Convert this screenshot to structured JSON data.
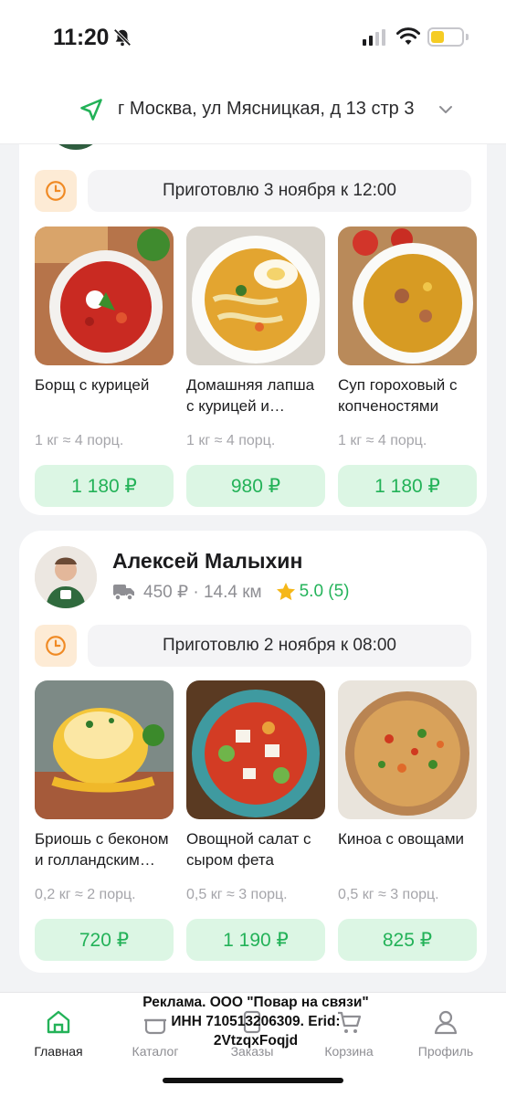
{
  "status_bar": {
    "time": "11:20",
    "battery_color": "#f5cc23"
  },
  "header": {
    "address": "г Москва, ул Мясницкая, д 13 стр 3",
    "location_icon": "navigation-arrow-icon",
    "chevron_icon": "chevron-down-icon"
  },
  "cards": [
    {
      "ready_text": "Приготовлю 3 ноября к 12:00",
      "dishes": [
        {
          "name": "Борщ с курицей",
          "weight": "1 кг ≈ 4 порц.",
          "price": "1 180 ₽"
        },
        {
          "name": "Домашняя лапша с курицей и…",
          "weight": "1 кг ≈ 4 порц.",
          "price": "980 ₽"
        },
        {
          "name": "Суп гороховый с копченостями",
          "weight": "1 кг ≈ 4 порц.",
          "price": "1 180 ₽"
        }
      ]
    },
    {
      "chef_name": "Алексей Малыхин",
      "delivery": "450 ₽ · 14.4 км",
      "rating": "5.0 (5)",
      "ready_text": "Приготовлю 2 ноября к 08:00",
      "dishes": [
        {
          "name": "Бриошь с беконом и голландским…",
          "weight": "0,2 кг ≈ 2 порц.",
          "price": "720 ₽"
        },
        {
          "name": "Овощной салат с сыром фета",
          "weight": "0,5 кг ≈ 3 порц.",
          "price": "1 190 ₽"
        },
        {
          "name": "Киноа с овощами",
          "weight": "0,5 кг ≈ 3 порц.",
          "price": "825 ₽"
        }
      ]
    }
  ],
  "ad": {
    "line1": "Реклама. ООО \"Повар на связи\"",
    "line2": "ИНН 710513206309. Erid:",
    "line3": "2VtzqxFoqjd"
  },
  "tabs": [
    {
      "label": "Главная",
      "icon": "home-icon",
      "active": true
    },
    {
      "label": "Каталог",
      "icon": "cooking-pot-icon",
      "active": false
    },
    {
      "label": "Заказы",
      "icon": "orders-icon",
      "active": false
    },
    {
      "label": "Корзина",
      "icon": "cart-icon",
      "active": false
    },
    {
      "label": "Профиль",
      "icon": "profile-icon",
      "active": false
    }
  ],
  "colors": {
    "accent_green": "#23b258",
    "price_bg": "#dcf6e4",
    "clock_bg": "#fdebd5",
    "clock_icon": "#f08a24",
    "star": "#f5b718"
  }
}
